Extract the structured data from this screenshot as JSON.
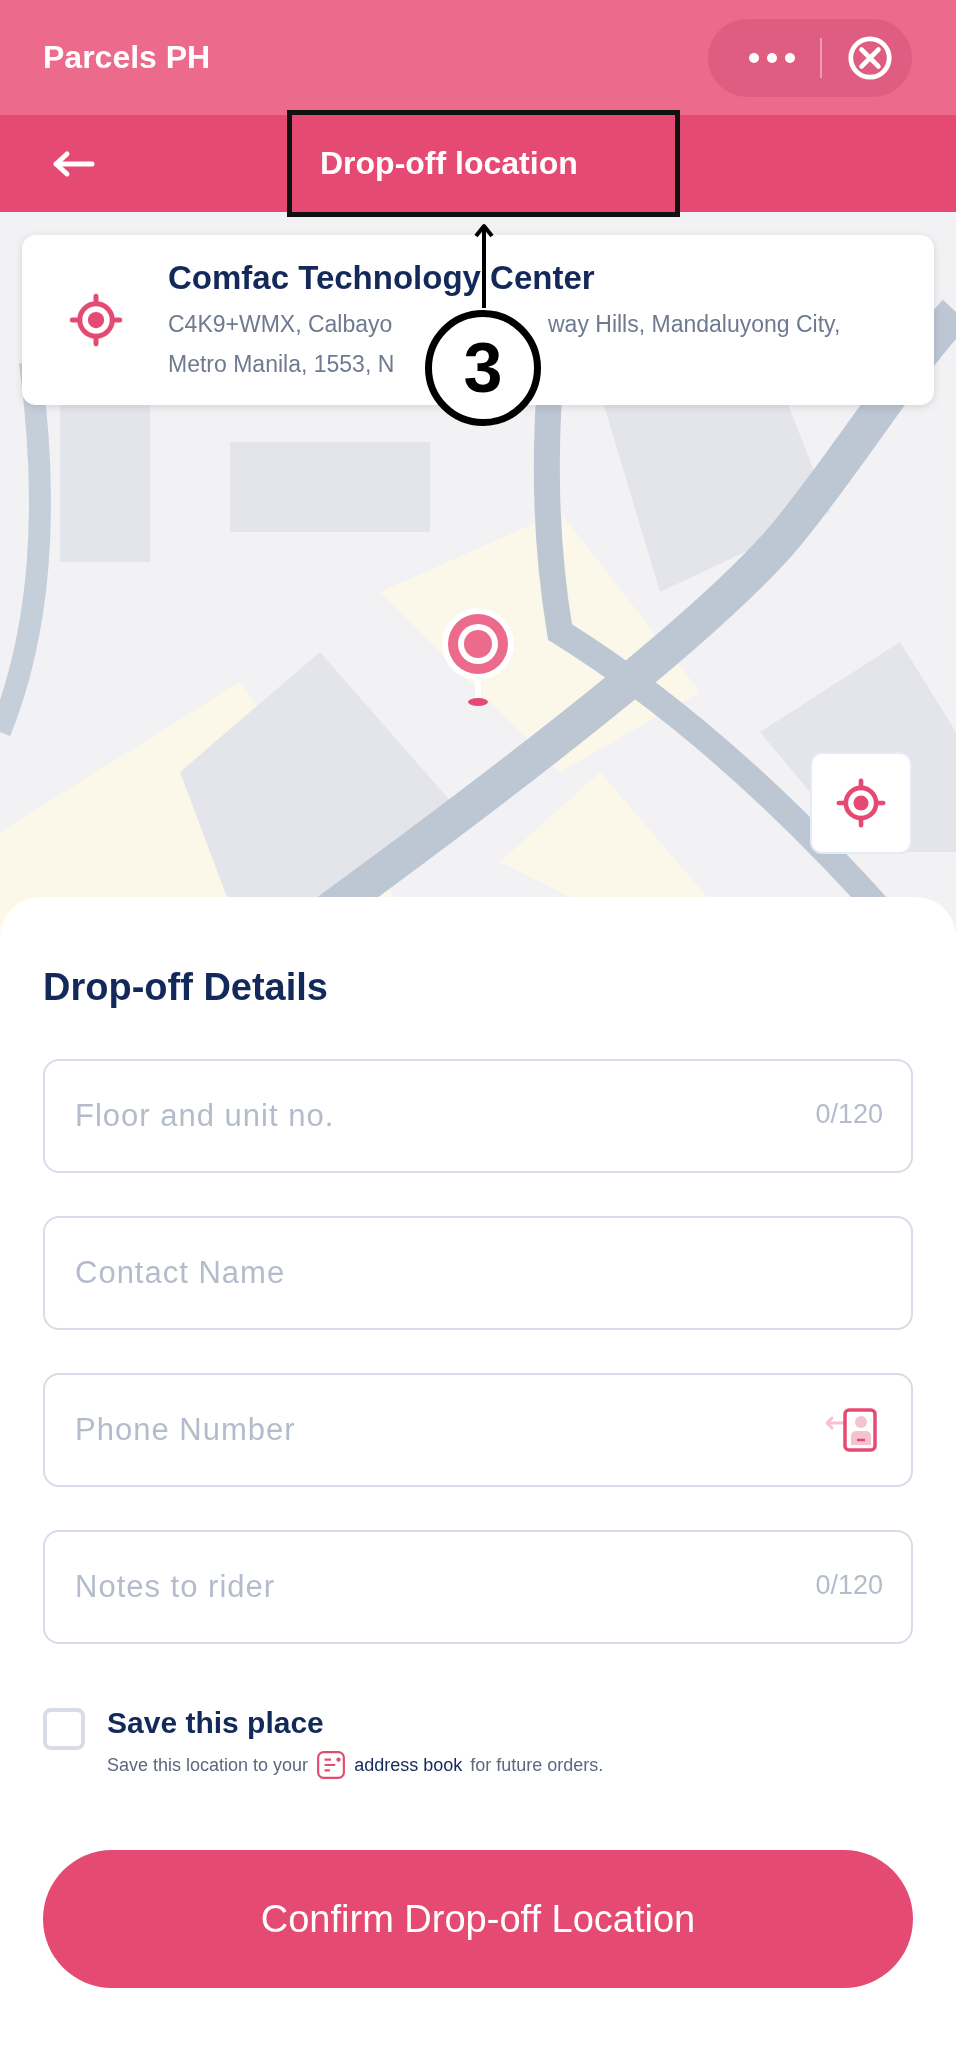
{
  "app_bar": {
    "title": "Parcels PH"
  },
  "header": {
    "title": "Drop-off location"
  },
  "location_card": {
    "name": "Comfac Technology Center",
    "address_lines": [
      [
        "C4K9+WMX, Calbayo",
        "way Hills, Mandaluyong City,"
      ],
      [
        "Metro Manila, 1553, N"
      ]
    ]
  },
  "details": {
    "title": "Drop-off Details",
    "fields": [
      {
        "kind": "counter",
        "placeholder": "Floor and unit no.",
        "counter": "0/120"
      },
      {
        "kind": "plain",
        "placeholder": "Contact Name"
      },
      {
        "kind": "contacts",
        "placeholder": "Phone Number"
      },
      {
        "kind": "counter",
        "placeholder": "Notes to rider",
        "counter": "0/120"
      }
    ]
  },
  "save_place": {
    "checked": false,
    "label": "Save this place",
    "hint_before": "Save this location to your",
    "link": "address book",
    "hint_after": "for future orders."
  },
  "confirm_button": "Confirm Drop-off Location",
  "annotation": {
    "number": "3"
  }
}
